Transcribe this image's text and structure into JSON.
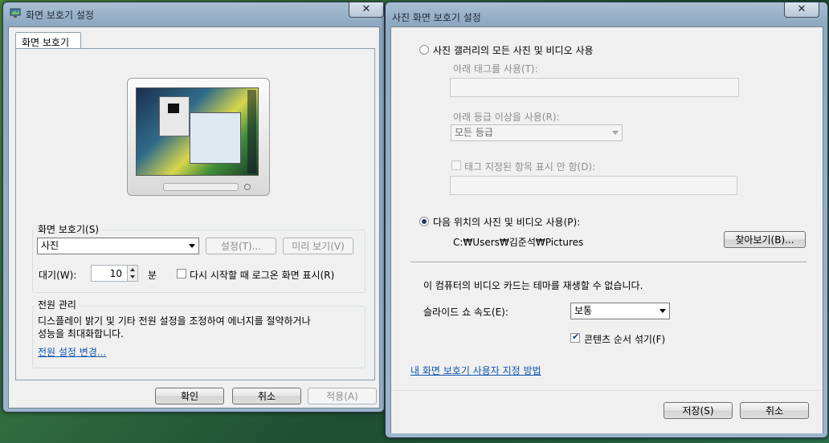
{
  "left_window": {
    "title": "화면 보호기 설정",
    "close_glyph": "✕",
    "tab_label": "화면 보호기",
    "saver_group_label": "화면 보호기(S)",
    "saver_value": "사진",
    "settings_button": "설정(T)...",
    "preview_button": "미리 보기(V)",
    "wait_label": "대기(W):",
    "wait_value": "10",
    "wait_unit": "분",
    "resume_label": "다시 시작할 때 로그온 화면 표시(R)",
    "power_group_label": "전원 관리",
    "power_desc_line1": "디스플레이 밝기 및 기타 전원 설정을 조정하여 에너지를 절약하거나",
    "power_desc_line2": "성능을 최대화합니다.",
    "power_link": "전원 설정 변경...",
    "ok_button": "확인",
    "cancel_button": "취소",
    "apply_button": "적용(A)"
  },
  "right_window": {
    "title": "사진 화면 보호기 설정",
    "close_glyph": "✕",
    "option_gallery": "사진 갤러리의 모든 사진 및 비디오 사용",
    "tag_label": "아래 태그를 사용(T):",
    "rating_label": "아래 등급 이상을 사용(R):",
    "rating_value": "모든 등급",
    "hide_tagged_label": "태그 지정된 항목 표시 안 함(D):",
    "option_folder": "다음 위치의 사진 및 비디오 사용(P):",
    "folder_path": "C:₩Users₩김준석₩Pictures",
    "browse_button": "찾아보기(B)...",
    "theme_message": "이 컴퓨터의 비디오 카드는 테마를 재생할 수 없습니다.",
    "speed_label": "슬라이드 쇼 속도(E):",
    "speed_value": "보통",
    "shuffle_label": "콘텐츠 순서 섞기(F)",
    "customize_link": "내 화면 보호기 사용자 지정 방법",
    "save_button": "저장(S)",
    "cancel_button": "취소"
  },
  "colors": {
    "link": "#0f56b1",
    "radio_dot": "#1b3a63",
    "disabled_text": "#8d8d8d"
  }
}
